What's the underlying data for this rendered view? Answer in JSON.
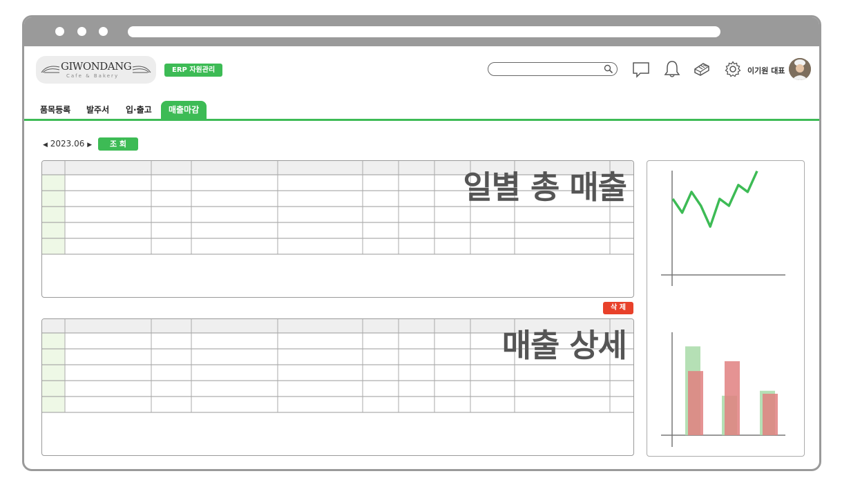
{
  "header": {
    "logo_text": "GIWONDANG",
    "logo_sub": "Cafe & Bakery",
    "erp_badge": "ERP 자원관리",
    "user_name": "이기원 대표"
  },
  "tabs": [
    {
      "label": "품목등록",
      "active": false
    },
    {
      "label": "발주서",
      "active": false
    },
    {
      "label": "입·출고",
      "active": false
    },
    {
      "label": "매출마감",
      "active": true
    }
  ],
  "period": {
    "value": "2023.06",
    "prev_icon": "triangle-left",
    "next_icon": "triangle-right"
  },
  "query_button": "조 회",
  "delete_button": "삭 제",
  "daily_grid": {
    "title": "일별 총 매출"
  },
  "detail_grid": {
    "title": "매출 상세"
  },
  "colors": {
    "accent": "#3dbb55",
    "danger": "#e8412a",
    "frame": "#9a9a9a"
  },
  "chart_data": [
    {
      "type": "line",
      "series": [
        {
          "values": [
            5,
            3,
            6,
            4,
            1,
            5,
            4,
            7,
            6,
            9
          ]
        }
      ]
    },
    {
      "type": "bar",
      "categories": [
        "",
        "",
        ""
      ],
      "series": [
        {
          "values": [
            9,
            4,
            4.5
          ],
          "color": "#a8dba8"
        },
        {
          "values": [
            6.5,
            7.5,
            4.2
          ],
          "color": "#e08080"
        }
      ]
    }
  ]
}
